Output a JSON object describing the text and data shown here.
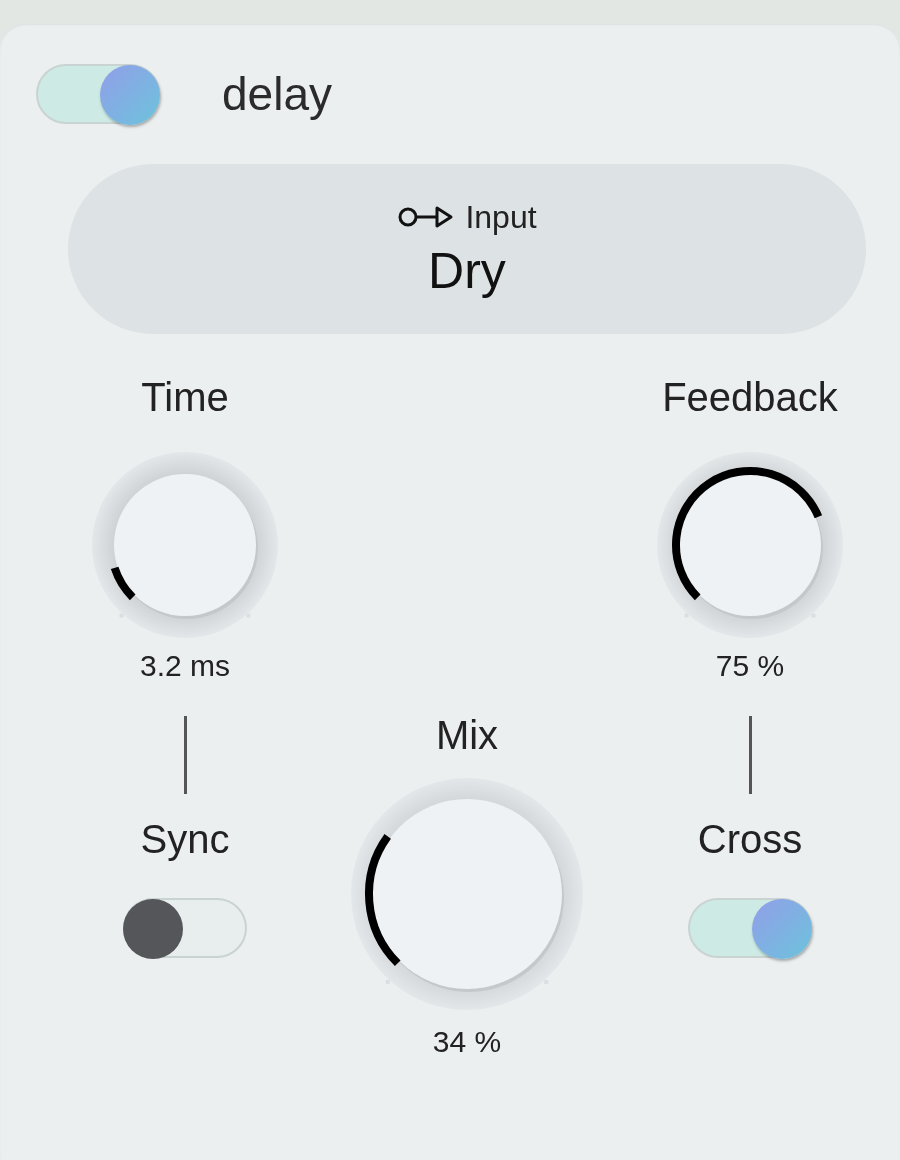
{
  "module": {
    "title": "delay",
    "enabled": true
  },
  "input": {
    "label": "Input",
    "value": "Dry"
  },
  "knobs": [
    {
      "label": "Time",
      "reading": "3.2 ms"
    },
    {
      "label": "Feedback",
      "reading": "75 %"
    },
    {
      "label": "Mix",
      "reading": "34 %"
    }
  ],
  "switches": [
    {
      "label": "Sync",
      "on": false
    },
    {
      "label": "Cross",
      "on": true
    }
  ]
}
